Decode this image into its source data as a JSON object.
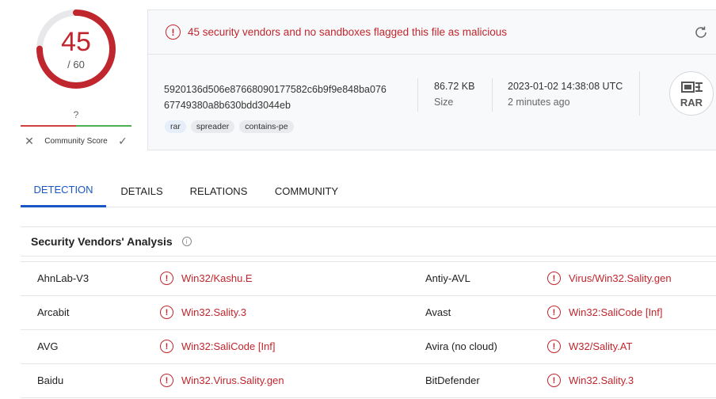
{
  "score": {
    "detected": "45",
    "total": "/ 60",
    "fraction": 0.75,
    "color": "#c0262d"
  },
  "community": {
    "value": "?",
    "label": "Community Score"
  },
  "summary": {
    "alert": "45 security vendors and no sandboxes flagged this file as malicious",
    "hash_line1": "5920136d506e87668090177582c6b9f9e848ba076",
    "hash_line2": "67749380a8b630bdd3044eb",
    "tags": [
      "rar",
      "spreader",
      "contains-pe"
    ],
    "size_value": "86.72 KB",
    "size_label": "Size",
    "date_value": "2023-01-02 14:38:08 UTC",
    "date_relative": "2 minutes ago",
    "file_type": "RAR"
  },
  "tabs": [
    "DETECTION",
    "DETAILS",
    "RELATIONS",
    "COMMUNITY"
  ],
  "vendors": {
    "title": "Security Vendors' Analysis",
    "rows": [
      {
        "left_name": "AhnLab-V3",
        "left_result": "Win32/Kashu.E",
        "right_name": "Antiy-AVL",
        "right_result": "Virus/Win32.Sality.gen"
      },
      {
        "left_name": "Arcabit",
        "left_result": "Win32.Sality.3",
        "right_name": "Avast",
        "right_result": "Win32:SaliCode [Inf]"
      },
      {
        "left_name": "AVG",
        "left_result": "Win32:SaliCode [Inf]",
        "right_name": "Avira (no cloud)",
        "right_result": "W32/Sality.AT"
      },
      {
        "left_name": "Baidu",
        "left_result": "Win32.Virus.Sality.gen",
        "right_name": "BitDefender",
        "right_result": "Win32.Sality.3"
      }
    ]
  }
}
